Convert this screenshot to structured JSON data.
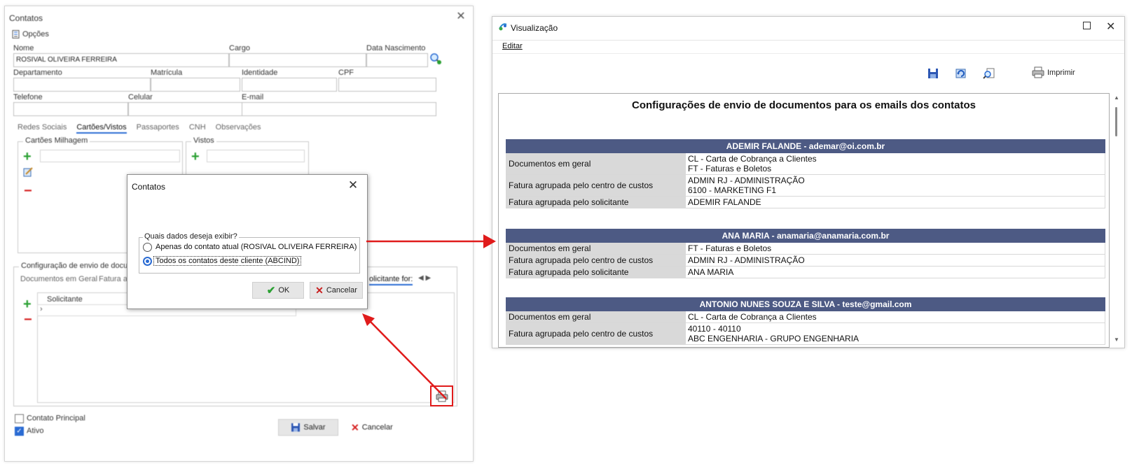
{
  "left_window": {
    "title": "Contatos",
    "options_label": "Opções",
    "fields": {
      "nome_label": "Nome",
      "nome_value": "ROSIVAL OLIVEIRA FERREIRA",
      "cargo_label": "Cargo",
      "data_nascimento_label": "Data Nascimento",
      "departamento_label": "Departamento",
      "matricula_label": "Matrícula",
      "identidade_label": "Identidade",
      "cpf_label": "CPF",
      "telefone_label": "Telefone",
      "celular_label": "Celular",
      "email_label": "E-mail"
    },
    "tabs": [
      "Redes Sociais",
      "Cartões/Vistos",
      "Passaportes",
      "CNH",
      "Observações"
    ],
    "active_tab": "Cartões/Vistos",
    "group_cartoes": "Cartões Milhagem",
    "group_vistos": "Vistos",
    "config_group_title": "Configuração de envio de docum",
    "config_tabs": [
      "Documentos em Geral",
      "Fatura a",
      "olicitante for:"
    ],
    "grid_header_solicitante": "Solicitante",
    "contato_principal_label": "Contato Principal",
    "ativo_label": "Ativo",
    "salvar_label": "Salvar",
    "cancelar_label": "Cancelar"
  },
  "dialog": {
    "title": "Contatos",
    "question": "Quais dados deseja exibir?",
    "option_current": "Apenas do contato atual (ROSIVAL OLIVEIRA FERREIRA)",
    "option_all": "Todos os contatos deste cliente (ABCIND)",
    "selected": "option_all",
    "ok_label": "OK",
    "cancel_label": "Cancelar"
  },
  "right_window": {
    "title": "Visualização",
    "menu_editar": "Editar",
    "print_label": "Imprimir",
    "report_title": "Configurações de envio de documentos para os emails dos contatos",
    "contacts": [
      {
        "header": "ADEMIR FALANDE - ademar@oi.com.br",
        "rows": [
          {
            "key": "Documentos em geral",
            "values": [
              "CL - Carta de Cobrança a Clientes",
              "FT - Faturas e Boletos"
            ]
          },
          {
            "key": "Fatura agrupada pelo centro de custos",
            "values": [
              "ADMIN RJ - ADMINISTRAÇÃO",
              "6100 - MARKETING F1"
            ]
          },
          {
            "key": "Fatura agrupada pelo solicitante",
            "values": [
              "ADEMIR FALANDE"
            ]
          }
        ]
      },
      {
        "header": "ANA MARIA - anamaria@anamaria.com.br",
        "rows": [
          {
            "key": "Documentos em geral",
            "values": [
              "FT - Faturas e Boletos"
            ]
          },
          {
            "key": "Fatura agrupada pelo centro de custos",
            "values": [
              "ADMIN RJ - ADMINISTRAÇÃO"
            ]
          },
          {
            "key": "Fatura agrupada pelo solicitante",
            "values": [
              "ANA MARIA"
            ]
          }
        ]
      },
      {
        "header": "ANTONIO NUNES SOUZA E SILVA - teste@gmail.com",
        "rows": [
          {
            "key": "Documentos em geral",
            "values": [
              "CL - Carta de Cobrança a Clientes"
            ]
          },
          {
            "key": "Fatura agrupada pelo centro de custos",
            "values": [
              "40110 - 40110",
              "ABC ENGENHARIA - GRUPO ENGENHARIA"
            ]
          }
        ]
      }
    ]
  },
  "colors": {
    "accent_blue": "#2a6bd3",
    "report_header": "#4d5a84",
    "key_cell": "#d9d9d9",
    "annotation_red": "#e01b1b",
    "add_green": "#2aa032",
    "remove_red": "#d62020"
  },
  "icons": [
    "options-icon",
    "search-person-icon",
    "add-icon",
    "edit-icon",
    "remove-icon",
    "print-icon",
    "save-icon",
    "refresh-icon",
    "zoom-icon",
    "close-icon",
    "maximize-icon",
    "check-icon",
    "x-icon",
    "app-icon"
  ]
}
